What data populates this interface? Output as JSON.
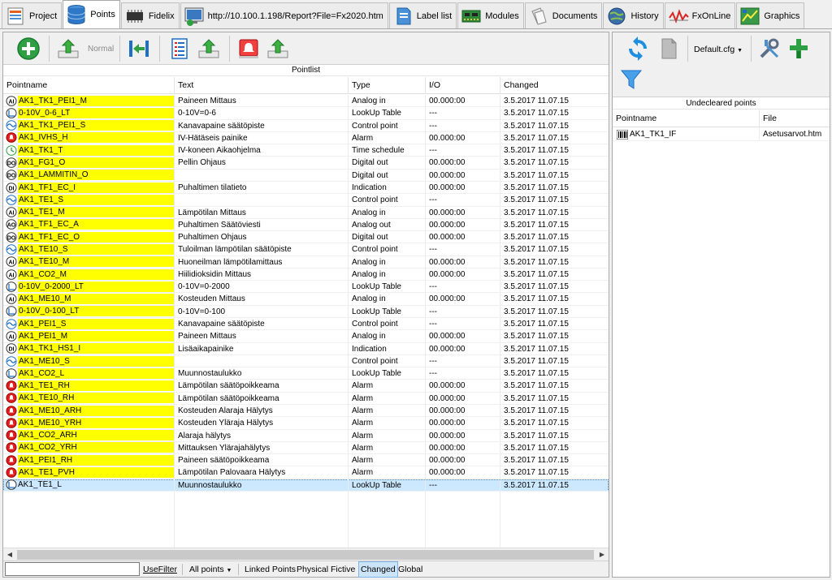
{
  "tabs": [
    {
      "label": "Project",
      "icon": "project-icon",
      "active": false
    },
    {
      "label": "Points",
      "icon": "database-icon",
      "active": true
    },
    {
      "label": "Fidelix",
      "icon": "chip-icon",
      "active": false
    },
    {
      "label": "http://10.100.1.198/Report?File=Fx2020.htm",
      "icon": "web-report-icon",
      "active": false
    },
    {
      "label": "Label list",
      "icon": "label-icon",
      "active": false
    },
    {
      "label": "Modules",
      "icon": "circuit-board-icon",
      "active": false
    },
    {
      "label": "Documents",
      "icon": "documents-icon",
      "active": false
    },
    {
      "label": "History",
      "icon": "globe-clock-icon",
      "active": false
    },
    {
      "label": "FxOnLine",
      "icon": "online-wave-icon",
      "active": false
    },
    {
      "label": "Graphics",
      "icon": "graphics-icon",
      "active": false
    }
  ],
  "toolbar": {
    "normal_label": "Normal"
  },
  "pointlist": {
    "title": "Pointlist",
    "columns": [
      "Pointname",
      "Text",
      "Type",
      "I/O",
      "Changed"
    ],
    "rows": [
      {
        "name": "AK1_TK1_PEI1_M",
        "icon": "AI",
        "text": "Paineen Mittaus",
        "type": "Analog in",
        "io": "00.000:00",
        "changed": "3.5.2017 11.07.15"
      },
      {
        "name": "0-10V_0-6_LT",
        "icon": "LT",
        "text": "0-10V=0-6",
        "type": "LookUp Table",
        "io": "---",
        "changed": "3.5.2017 11.07.15"
      },
      {
        "name": "AK1_TK1_PEI1_S",
        "icon": "CP",
        "text": "Kanavapaine säätöpiste",
        "type": "Control point",
        "io": "---",
        "changed": "3.5.2017 11.07.15"
      },
      {
        "name": "AK1_IVHS_H",
        "icon": "AL",
        "text": "IV-Hätäseis painike",
        "type": "Alarm",
        "io": "00.000:00",
        "changed": "3.5.2017 11.07.15"
      },
      {
        "name": "AK1_TK1_T",
        "icon": "TS",
        "text": "IV-koneen Aikaohjelma",
        "type": "Time schedule",
        "io": "---",
        "changed": "3.5.2017 11.07.15"
      },
      {
        "name": "AK1_FG1_O",
        "icon": "DO",
        "text": "Pellin Ohjaus",
        "type": "Digital out",
        "io": "00.000:00",
        "changed": "3.5.2017 11.07.15"
      },
      {
        "name": "AK1_LAMMITIN_O",
        "icon": "DO",
        "text": "",
        "type": "Digital out",
        "io": "00.000:00",
        "changed": "3.5.2017 11.07.15"
      },
      {
        "name": "AK1_TF1_EC_I",
        "icon": "DI",
        "text": "Puhaltimen tilatieto",
        "type": "Indication",
        "io": "00.000:00",
        "changed": "3.5.2017 11.07.15"
      },
      {
        "name": "AK1_TE1_S",
        "icon": "CP",
        "text": "",
        "type": "Control point",
        "io": "---",
        "changed": "3.5.2017 11.07.15"
      },
      {
        "name": "AK1_TE1_M",
        "icon": "AI",
        "text": "Lämpötilan Mittaus",
        "type": "Analog in",
        "io": "00.000:00",
        "changed": "3.5.2017 11.07.15"
      },
      {
        "name": "AK1_TF1_EC_A",
        "icon": "AO",
        "text": "Puhaltimen Säätöviesti",
        "type": "Analog out",
        "io": "00.000:00",
        "changed": "3.5.2017 11.07.15"
      },
      {
        "name": "AK1_TF1_EC_O",
        "icon": "DO",
        "text": "Puhaltimen Ohjaus",
        "type": "Digital out",
        "io": "00.000:00",
        "changed": "3.5.2017 11.07.15"
      },
      {
        "name": "AK1_TE10_S",
        "icon": "CP",
        "text": "Tuloilman lämpötilan säätöpiste",
        "type": "Control point",
        "io": "---",
        "changed": "3.5.2017 11.07.15"
      },
      {
        "name": "AK1_TE10_M",
        "icon": "AI",
        "text": "Huoneilman lämpötilamittaus",
        "type": "Analog in",
        "io": "00.000:00",
        "changed": "3.5.2017 11.07.15"
      },
      {
        "name": "AK1_CO2_M",
        "icon": "AI",
        "text": "Hiilidioksidin Mittaus",
        "type": "Analog in",
        "io": "00.000:00",
        "changed": "3.5.2017 11.07.15"
      },
      {
        "name": "0-10V_0-2000_LT",
        "icon": "LT",
        "text": "0-10V=0-2000",
        "type": "LookUp Table",
        "io": "---",
        "changed": "3.5.2017 11.07.15"
      },
      {
        "name": "AK1_ME10_M",
        "icon": "AI",
        "text": "Kosteuden Mittaus",
        "type": "Analog in",
        "io": "00.000:00",
        "changed": "3.5.2017 11.07.15"
      },
      {
        "name": "0-10V_0-100_LT",
        "icon": "LT",
        "text": "0-10V=0-100",
        "type": "LookUp Table",
        "io": "---",
        "changed": "3.5.2017 11.07.15"
      },
      {
        "name": "AK1_PEI1_S",
        "icon": "CP",
        "text": "Kanavapaine säätöpiste",
        "type": "Control point",
        "io": "---",
        "changed": "3.5.2017 11.07.15"
      },
      {
        "name": "AK1_PEI1_M",
        "icon": "AI",
        "text": "Paineen Mittaus",
        "type": "Analog in",
        "io": "00.000:00",
        "changed": "3.5.2017 11.07.15"
      },
      {
        "name": "AK1_TK1_HS1_I",
        "icon": "DI",
        "text": "Lisäaikapainike",
        "type": "Indication",
        "io": "00.000:00",
        "changed": "3.5.2017 11.07.15"
      },
      {
        "name": "AK1_ME10_S",
        "icon": "CP",
        "text": "",
        "type": "Control point",
        "io": "---",
        "changed": "3.5.2017 11.07.15"
      },
      {
        "name": "AK1_CO2_L",
        "icon": "LT",
        "text": "Muunnostaulukko",
        "type": "LookUp Table",
        "io": "---",
        "changed": "3.5.2017 11.07.15"
      },
      {
        "name": "AK1_TE1_RH",
        "icon": "AL",
        "text": "Lämpötilan säätöpoikkeama",
        "type": "Alarm",
        "io": "00.000:00",
        "changed": "3.5.2017 11.07.15"
      },
      {
        "name": "AK1_TE10_RH",
        "icon": "AL",
        "text": "Lämpötilan säätöpoikkeama",
        "type": "Alarm",
        "io": "00.000:00",
        "changed": "3.5.2017 11.07.15"
      },
      {
        "name": "AK1_ME10_ARH",
        "icon": "AL",
        "text": "Kosteuden Alaraja Hälytys",
        "type": "Alarm",
        "io": "00.000:00",
        "changed": "3.5.2017 11.07.15"
      },
      {
        "name": "AK1_ME10_YRH",
        "icon": "AL",
        "text": "Kosteuden Yläraja Hälytys",
        "type": "Alarm",
        "io": "00.000:00",
        "changed": "3.5.2017 11.07.15"
      },
      {
        "name": "AK1_CO2_ARH",
        "icon": "AL",
        "text": "Alaraja hälytys",
        "type": "Alarm",
        "io": "00.000:00",
        "changed": "3.5.2017 11.07.15"
      },
      {
        "name": "AK1_CO2_YRH",
        "icon": "AL",
        "text": "Mittauksen Ylärajahälytys",
        "type": "Alarm",
        "io": "00.000:00",
        "changed": "3.5.2017 11.07.15"
      },
      {
        "name": "AK1_PEI1_RH",
        "icon": "AL",
        "text": "Paineen säätöpoikkeama",
        "type": "Alarm",
        "io": "00.000:00",
        "changed": "3.5.2017 11.07.15"
      },
      {
        "name": "AK1_TE1_PVH",
        "icon": "AL",
        "text": "Lämpötilan Palovaara Hälytys",
        "type": "Alarm",
        "io": "00.000:00",
        "changed": "3.5.2017 11.07.15"
      },
      {
        "name": "AK1_TE1_L",
        "icon": "LT",
        "text": "Muunnostaulukko",
        "type": "LookUp Table",
        "io": "---",
        "changed": "3.5.2017 11.07.15",
        "selected": true,
        "highlight": false
      }
    ]
  },
  "bottombar": {
    "filter_value": "",
    "use_filter": "UseFilter",
    "all_points": "All points",
    "linked_points": "Linked Points",
    "physical": "Physical",
    "fictive": "Fictive",
    "changed": "Changed",
    "global": "Global"
  },
  "right_panel": {
    "config": "Default.cfg",
    "title": "Undecleared points",
    "columns": [
      "Pointname",
      "File"
    ],
    "rows": [
      {
        "name": "AK1_TK1_IF",
        "icon": "barcode-icon",
        "file": "Asetusarvot.htm"
      }
    ]
  },
  "colors": {
    "highlight": "#ffff00",
    "selection": "#cce8ff",
    "alarm_red": "#e02020",
    "accent_blue": "#1e6fc8",
    "accent_green": "#2ea043"
  }
}
